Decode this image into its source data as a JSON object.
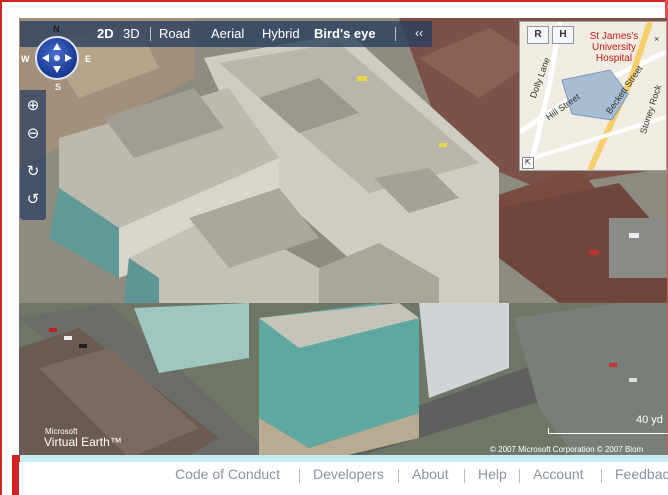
{
  "nav": {
    "items": [
      {
        "label": "2D",
        "bold": true
      },
      {
        "label": "3D",
        "bold": false
      },
      {
        "label": "Road",
        "bold": false
      },
      {
        "label": "Aerial",
        "bold": false
      },
      {
        "label": "Hybrid",
        "bold": false
      },
      {
        "label": "Bird's eye",
        "bold": true
      }
    ],
    "collapse_label": "‹‹"
  },
  "compass": {
    "n": "N",
    "s": "S",
    "e": "E",
    "w": "W"
  },
  "controls": {
    "zoom_in": "⊕",
    "zoom_out": "⊖",
    "rotate_cw": "↻",
    "rotate_ccw": "↺"
  },
  "minimap": {
    "buttons": [
      "R",
      "H"
    ],
    "hospital_label": "St James's University Hospital",
    "streets": [
      "Dolly Lane",
      "Hill Street",
      "Beckett Street",
      "Stoney Rock"
    ],
    "close_label": "×",
    "resize_label": "⇱"
  },
  "branding": {
    "company": "Microsoft",
    "product": "Virtual Earth™"
  },
  "copyright": "© 2007 Microsoft Corporation   © 2007 Blom",
  "scale": "40 yd",
  "footer": {
    "links": [
      "Code of Conduct",
      "Developers",
      "About",
      "Help",
      "Account",
      "Feedback"
    ]
  }
}
